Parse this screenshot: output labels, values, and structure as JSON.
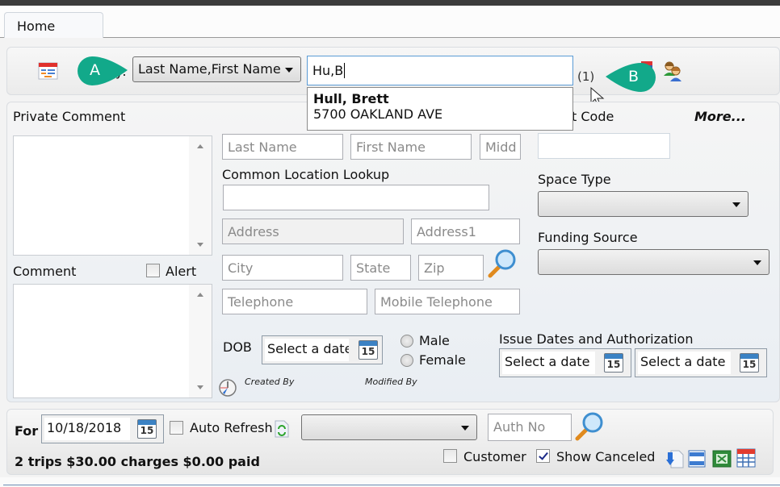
{
  "tabs": [
    {
      "label": "Home",
      "active": true
    }
  ],
  "search": {
    "search_by_label_partial": "y:",
    "search_by_selected": "Last Name,First Name",
    "query_value": "Hu,B",
    "result_count": "(1)",
    "suggestions": [
      {
        "name": "Hull, Brett",
        "address": "5700 OAKLAND AVE"
      }
    ],
    "icons": [
      "calendar-list-icon",
      "users-icon"
    ]
  },
  "annotations": {
    "a": "A",
    "b": "B",
    "color": "#12a98a"
  },
  "left": {
    "private_comment_label": "Private Comment",
    "comment_label": "Comment",
    "alert_label": "Alert",
    "alert_checked": false
  },
  "form": {
    "last_name_placeholder": "Last Name",
    "first_name_placeholder": "First Name",
    "middle_placeholder": "Midd",
    "common_location_label": "Common Location Lookup",
    "address_placeholder": "Address",
    "address1_placeholder": "Address1",
    "city_placeholder": "City",
    "state_placeholder": "State",
    "zip_placeholder": "Zip",
    "telephone_placeholder": "Telephone",
    "mobile_placeholder": "Mobile Telephone",
    "dob_label": "DOB",
    "dob_placeholder": "Select a date",
    "male_label": "Male",
    "female_label": "Female",
    "created_by_label": "Created By",
    "modified_by_label": "Modified By",
    "calendar_day": "15"
  },
  "right": {
    "code_label_partial": "t Code",
    "more_label": "More...",
    "space_type_label": "Space Type",
    "space_type_value": "",
    "funding_source_label": "Funding Source",
    "funding_source_value": "",
    "issue_dates_label": "Issue Dates and Authorization",
    "issue_date_placeholder": "Select a date",
    "auth_date_placeholder": "Select a date"
  },
  "bottom": {
    "for_label": "For",
    "date_value": "10/18/2018",
    "auto_refresh_label": "Auto Refresh",
    "auto_refresh_checked": false,
    "filter_value": "",
    "auth_no_placeholder": "Auth No",
    "summary": "2 trips $30.00 charges $0.00 paid",
    "customer_label": "Customer",
    "customer_checked": false,
    "show_canceled_label": "Show Canceled",
    "show_canceled_checked": true,
    "toolbar_icons": [
      "export-icon",
      "rows-icon",
      "excel-icon",
      "table-icon"
    ]
  }
}
